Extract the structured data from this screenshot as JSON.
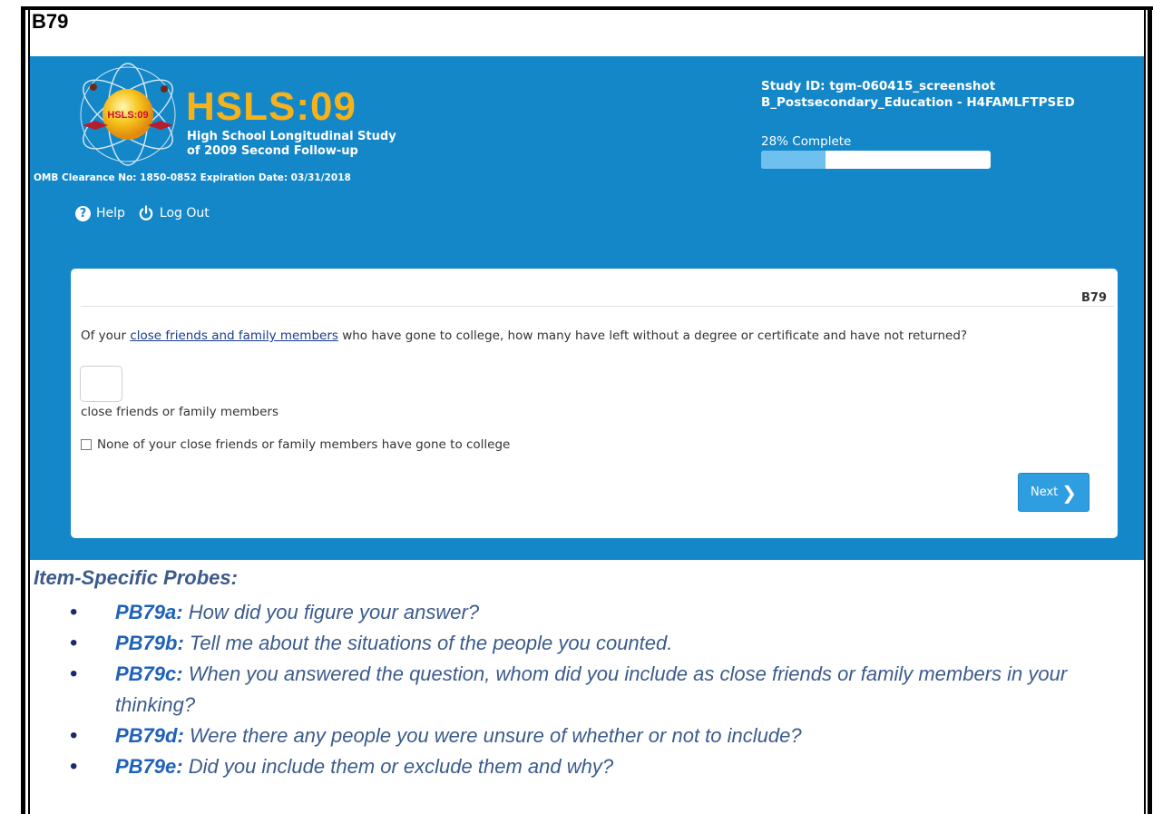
{
  "item_heading": "B79",
  "header": {
    "logo_text": "HSLS:09",
    "brand_title": "HSLS:09",
    "brand_subtitle_line1": "High School Longitudinal Study",
    "brand_subtitle_line2": "of 2009 Second Follow-up",
    "omb_text": "OMB Clearance No: 1850-0852 Expiration Date: 03/31/2018",
    "help_label": "Help",
    "logout_label": "Log Out",
    "study_id": "Study ID: tgm-060415_screenshot",
    "section": "B_Postsecondary_Education - H4FAMLFTPSED",
    "progress_label": "28% Complete",
    "progress_fraction": 0.28
  },
  "question": {
    "id": "B79",
    "text_before_link": "Of your ",
    "link_text": "close friends and family members",
    "text_after_link": " who have gone to college, how many have left without a degree or certificate and have not returned?",
    "input_value": "",
    "unit_label": "close friends or family members",
    "none_checkbox_label": "None of your close friends or family members have gone to college",
    "none_checked": false,
    "next_label": "Next"
  },
  "probes": {
    "heading": "Item-Specific Probes:",
    "items": [
      {
        "code": "PB79a:",
        "text": " How did you figure your answer?"
      },
      {
        "code": "PB79b:",
        "text": " Tell me about the situations of the people you counted."
      },
      {
        "code": "PB79c:",
        "text": " When you answered the question, whom did you include as close friends or family members in your thinking?"
      },
      {
        "code": "PB79d:",
        "text": " Were there any people you were unsure of whether or not to include?"
      },
      {
        "code": "PB79e:",
        "text": " Did you include them or exclude them and why?"
      }
    ]
  },
  "colors": {
    "screen_blue": "#1487c9",
    "brand_gold": "#f5b21b",
    "probe_text": "#3b5b8c",
    "probe_code": "#1f62b8"
  }
}
